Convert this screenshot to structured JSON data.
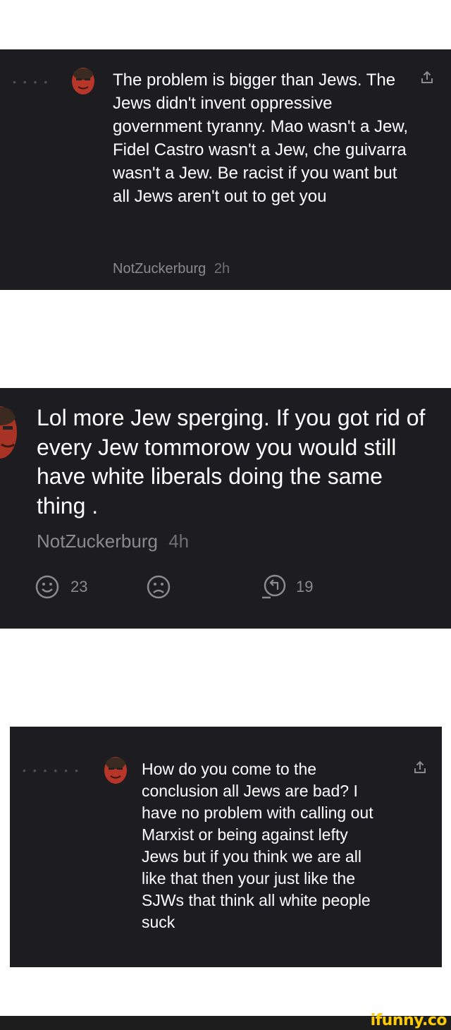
{
  "comments": [
    {
      "text": "The problem is bigger than Jews. The Jews didn't invent oppressive government tyranny. Mao wasn't a Jew, Fidel Castro wasn't a Jew, che guivarra wasn't a Jew. Be racist if you want but all Jews aren't out to get you",
      "author": "NotZuckerburg",
      "time": "2h"
    },
    {
      "text": "Lol more Jew sperging. If you got rid of every Jew tommorow you would still have white liberals doing the same thing .",
      "author": "NotZuckerburg",
      "time": "4h",
      "actions": {
        "smile_count": "23",
        "reply_count": "19"
      }
    },
    {
      "text": "How do you come to the conclusion all Jews are bad? I have no problem with calling out Marxist or being against lefty Jews but if you think we are all like that then your just like the SJWs that think all white people suck"
    }
  ],
  "icons": {
    "share": "share-icon",
    "smile": "smile-icon",
    "frown": "frown-icon",
    "reply": "reply-icon"
  },
  "watermark": "ifunny.co",
  "colors": {
    "panel_bg": "#1c1c21",
    "meta_gray": "#8a8a8f",
    "brand_yellow": "#ffcc00"
  }
}
